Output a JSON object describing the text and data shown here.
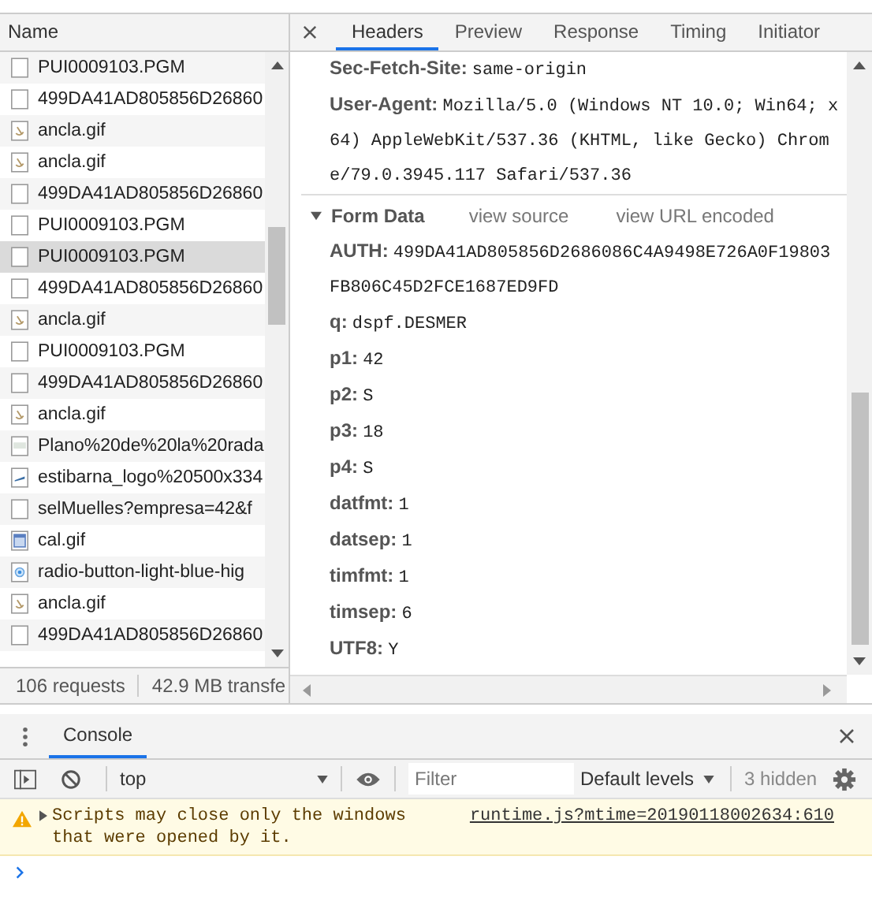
{
  "network": {
    "name_header": "Name",
    "files": [
      {
        "name": "PUI0009103.PGM",
        "kind": "doc",
        "selected": false
      },
      {
        "name": "499DA41AD805856D26860",
        "kind": "doc",
        "selected": false
      },
      {
        "name": "ancla.gif",
        "kind": "gif",
        "selected": false
      },
      {
        "name": "ancla.gif",
        "kind": "gif",
        "selected": false
      },
      {
        "name": "499DA41AD805856D26860",
        "kind": "doc",
        "selected": false
      },
      {
        "name": "PUI0009103.PGM",
        "kind": "doc",
        "selected": false
      },
      {
        "name": "PUI0009103.PGM",
        "kind": "doc",
        "selected": true
      },
      {
        "name": "499DA41AD805856D26860",
        "kind": "doc",
        "selected": false
      },
      {
        "name": "ancla.gif",
        "kind": "gif",
        "selected": false
      },
      {
        "name": "PUI0009103.PGM",
        "kind": "doc",
        "selected": false
      },
      {
        "name": "499DA41AD805856D26860",
        "kind": "doc",
        "selected": false
      },
      {
        "name": "ancla.gif",
        "kind": "gif",
        "selected": false
      },
      {
        "name": "Plano%20de%20la%20rada",
        "kind": "map",
        "selected": false
      },
      {
        "name": "estibarna_logo%20500x334",
        "kind": "logo",
        "selected": false
      },
      {
        "name": "selMuelles?empresa=42&f",
        "kind": "doc",
        "selected": false
      },
      {
        "name": "cal.gif",
        "kind": "cal",
        "selected": false
      },
      {
        "name": "radio-button-light-blue-hig",
        "kind": "radio",
        "selected": false
      },
      {
        "name": "ancla.gif",
        "kind": "gif",
        "selected": false
      },
      {
        "name": "499DA41AD805856D26860",
        "kind": "doc",
        "selected": false
      }
    ],
    "status": [
      "106 requests",
      "42.9 MB transfe"
    ]
  },
  "details": {
    "tabs": [
      {
        "label": "Headers",
        "selected": true
      },
      {
        "label": "Preview",
        "selected": false
      },
      {
        "label": "Response",
        "selected": false
      },
      {
        "label": "Timing",
        "selected": false
      },
      {
        "label": "Initiator",
        "selected": false
      }
    ],
    "headers": [
      {
        "key": "Sec-Fetch-Site:",
        "value": "same-origin"
      },
      {
        "key": "User-Agent:",
        "value": "Mozilla/5.0 (Windows NT 10.0; Win64; x64) AppleWebKit/537.36 (KHTML, like Gecko) Chrome/79.0.3945.117 Safari/537.36"
      }
    ],
    "form_data": {
      "title": "Form Data",
      "expanded": true,
      "links": [
        "view source",
        "view URL encoded"
      ],
      "fields": [
        {
          "key": "AUTH:",
          "value": "499DA41AD805856D2686086C4A9498E726A0F19803FB806C45D2FCE1687ED9FD"
        },
        {
          "key": "q:",
          "value": "dspf.DESMER"
        },
        {
          "key": "p1:",
          "value": "42"
        },
        {
          "key": "p2:",
          "value": "S"
        },
        {
          "key": "p3:",
          "value": "18"
        },
        {
          "key": "p4:",
          "value": "S"
        },
        {
          "key": "datfmt:",
          "value": "1"
        },
        {
          "key": "datsep:",
          "value": "1"
        },
        {
          "key": "timfmt:",
          "value": "1"
        },
        {
          "key": "timsep:",
          "value": "6"
        },
        {
          "key": "UTF8:",
          "value": "Y"
        }
      ]
    }
  },
  "drawer": {
    "tabs": [
      {
        "label": "Console",
        "selected": true
      }
    ]
  },
  "toolbar": {
    "context": "top",
    "filter_placeholder": "Filter",
    "levels": "Default levels",
    "hidden": "3 hidden"
  },
  "messages": [
    {
      "kind": "warning",
      "text": "Scripts may close only the windows that were opened by it.",
      "source": "runtime.js?mtime=20190118002634:610"
    }
  ]
}
